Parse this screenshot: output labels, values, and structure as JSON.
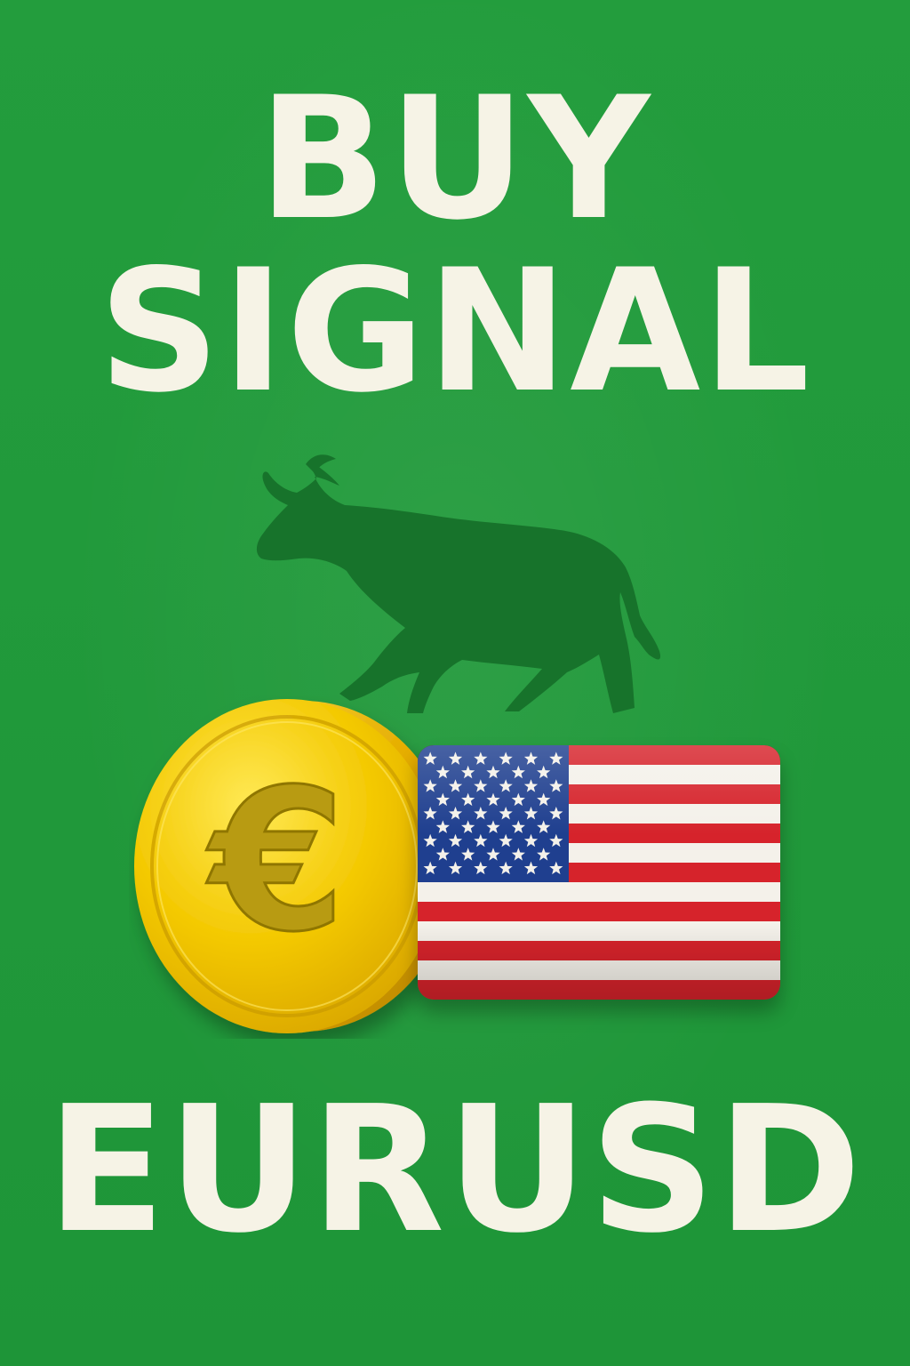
{
  "headline": {
    "line1": "BUY",
    "line2": "SIGNAL"
  },
  "pair": {
    "ticker": "EURUSD",
    "base_symbol": "€"
  },
  "icons": {
    "bull": "bull-silhouette-icon",
    "coin": "euro-coin-icon",
    "flag": "us-flag-icon"
  },
  "colors": {
    "background": "#1f9a3a",
    "text": "#f6f3e6",
    "bull": "#17732b",
    "coin_gold": "#f2c300",
    "flag_red": "#d6232b",
    "flag_blue": "#1f3f8f",
    "flag_white": "#f4f1ea"
  }
}
